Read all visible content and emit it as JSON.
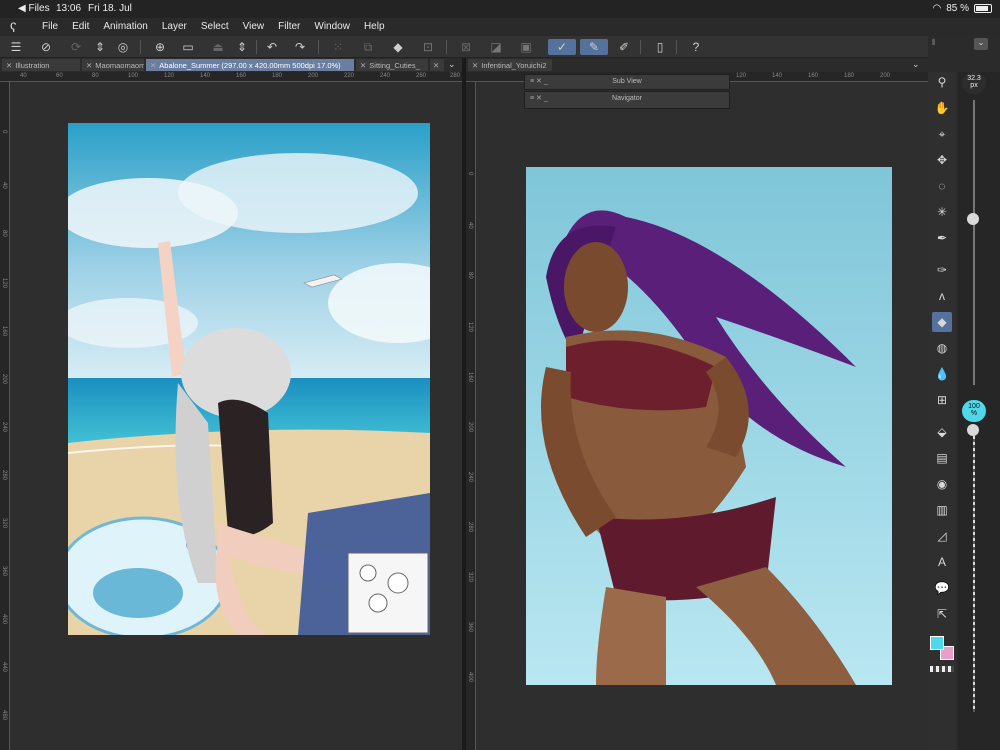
{
  "status": {
    "back": "◀ Files",
    "time": "13:06",
    "date": "Fri 18. Jul",
    "battery": "85 %"
  },
  "menu": {
    "items": [
      "File",
      "Edit",
      "Animation",
      "Layer",
      "Select",
      "View",
      "Filter",
      "Window",
      "Help"
    ]
  },
  "tabs_left": [
    {
      "label": "Illustration"
    },
    {
      "label": "Maomaomaomao"
    },
    {
      "label": "Abalone_Summer (297.00 x 420.00mm 500dpi 17.0%)"
    },
    {
      "label": "Sitting_Cuties_"
    }
  ],
  "tabs_right": [
    {
      "label": "Infentinal_Yoruichi2"
    }
  ],
  "rulers": {
    "left_h": [
      "40",
      "60",
      "80",
      "100",
      "120",
      "140",
      "160",
      "180",
      "200",
      "220",
      "240",
      "260",
      "280"
    ],
    "left_v": [
      "0",
      "40",
      "80",
      "120",
      "160",
      "200",
      "240",
      "280",
      "320",
      "360",
      "400",
      "440",
      "480"
    ],
    "right_h": [
      "120",
      "140",
      "160",
      "180",
      "200"
    ],
    "right_v": [
      "0",
      "40",
      "80",
      "120",
      "160",
      "200",
      "240",
      "280",
      "320",
      "360",
      "400"
    ]
  },
  "palettes": {
    "sub_view": "Sub View",
    "navigator": "Navigator"
  },
  "sliders": {
    "brush_size": "32.3",
    "brush_unit": "px",
    "opacity": "100",
    "opacity_unit": "%"
  },
  "colors": {
    "main": "#4fd7ea",
    "sub": "#e8a0c8",
    "accent": "#55729c"
  }
}
